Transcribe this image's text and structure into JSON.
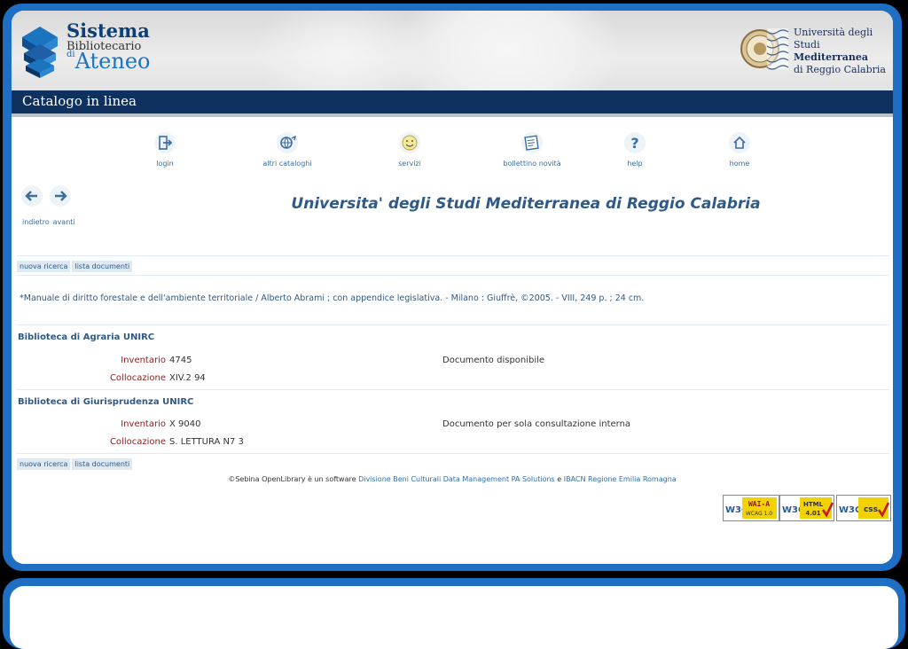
{
  "header": {
    "logo_line1": "Sistema",
    "logo_line2": "Bibliotecario",
    "logo_line3_prefix": "di",
    "logo_line3": "Ateneo",
    "university_line1": "Università degli Studi",
    "university_line2": "Mediterranea",
    "university_line3": "di Reggio Calabria"
  },
  "titlebar": {
    "label": "Catalogo in linea"
  },
  "toolbar": [
    {
      "label": "login",
      "icon": "login-icon"
    },
    {
      "label": "altri cataloghi",
      "icon": "world-icon"
    },
    {
      "label": "servizi",
      "icon": "smiley-icon"
    },
    {
      "label": "bollettino novità",
      "icon": "newspaper-icon"
    },
    {
      "label": "help",
      "icon": "help-icon"
    },
    {
      "label": "home",
      "icon": "home-icon"
    }
  ],
  "nav": {
    "back": "indietro",
    "forward": "avanti"
  },
  "page_title": "Universita' degli Studi Mediterranea di Reggio Calabria",
  "actions": {
    "new_search": "nuova ricerca",
    "doc_list": "lista documenti"
  },
  "record": {
    "description": "*Manuale di diritto forestale e dell'ambiente territoriale / Alberto Abrami ; con appendice legislativa. - Milano : Giuffrè, ©2005. - VIII, 249 p. ; 24 cm."
  },
  "holdings": [
    {
      "library": "Biblioteca di Agraria UNIRC",
      "inventory_label": "Inventario",
      "inventory": "4745",
      "location_label": "Collocazione",
      "location": "XIV.2 94",
      "status": "Documento disponibile"
    },
    {
      "library": "Biblioteca di Giurisprudenza UNIRC",
      "inventory_label": "Inventario",
      "inventory": "X 9040",
      "location_label": "Collocazione",
      "location": "S. LETTURA N7 3",
      "status": "Documento per sola consultazione interna"
    }
  ],
  "footer": {
    "prefix": "©Sebina OpenLibrary è un software",
    "link1": "Divisione Beni Culturali Data Management PA Solutions",
    "conj": "e",
    "link2": "IBACN Regione Emilia Romagna"
  },
  "badges": {
    "wai": {
      "w3c": "W3C",
      "line1": "WAI-A",
      "line2": "WCAG 1.0"
    },
    "html": {
      "w3c": "W3C",
      "line1": "HTML",
      "line2": "4.01"
    },
    "css": {
      "w3c": "W3C",
      "line1": "css"
    }
  },
  "colors": {
    "frame": "#1e6fc4",
    "titlebar": "#0f3160",
    "link": "#2f5a85",
    "label": "#8b1c1c"
  }
}
